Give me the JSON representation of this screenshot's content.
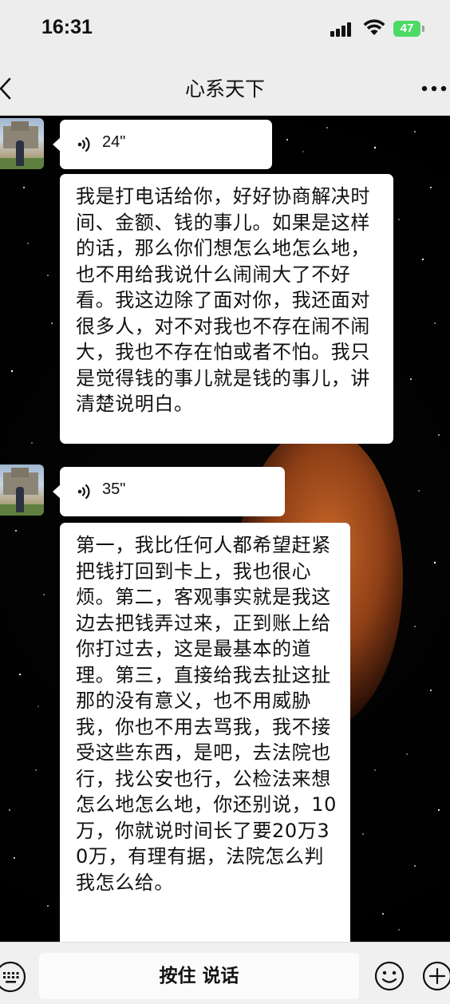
{
  "status_bar": {
    "time": "16:31",
    "battery": "47"
  },
  "nav": {
    "title": "心系天下"
  },
  "messages": [
    {
      "type": "voice",
      "duration": "24\""
    },
    {
      "type": "text",
      "text": "我是打电话给你，好好协商解决时间、金额、钱的事儿。如果是这样的话，那么你们想怎么地怎么地，也不用给我说什么闹闹大了不好看。我这边除了面对你，我还面对很多人，对不对我也不存在闹不闹大，我也不存在怕或者不怕。我只是觉得钱的事儿就是钱的事儿，讲清楚说明白。"
    },
    {
      "type": "voice",
      "duration": "35\""
    },
    {
      "type": "text",
      "text": "第一，我比任何人都希望赶紧把钱打回到卡上，我也很心烦。第二，客观事实就是我这边去把钱弄过来，正到账上给你打过去，这是最基本的道理。第三，直接给我去扯这扯那的没有意义，也不用威胁我，你也不用去骂我，我不接受这些东西，是吧，去法院也行，找公安也行，公检法来想怎么地怎么地，你还别说，10万，你就说时间长了要20万30万，有理有据，法院怎么判我怎么给。"
    }
  ],
  "input_bar": {
    "hold_to_talk": "按住 说话"
  },
  "colors": {
    "bar_bg": "#ededed",
    "bubble_bg": "#ffffff",
    "battery_green": "#4cd964"
  },
  "icons": [
    "back-icon",
    "more-icon",
    "voice-icon",
    "keyboard-icon",
    "emoji-icon",
    "plus-icon",
    "signal-icon",
    "wifi-icon",
    "battery-icon"
  ]
}
